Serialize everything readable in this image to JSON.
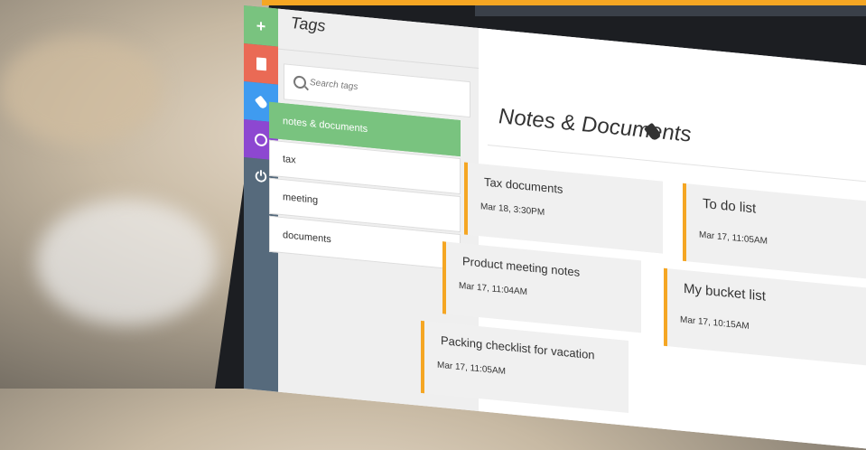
{
  "sidebar": {
    "items": [
      {
        "icon": "plus-icon",
        "color": "#79c37f"
      },
      {
        "icon": "document-icon",
        "color": "#ea6a55"
      },
      {
        "icon": "tag-icon",
        "color": "#3f9bf0"
      },
      {
        "icon": "clock-icon",
        "color": "#8d47d1"
      },
      {
        "icon": "power-icon",
        "color": "#566a7c"
      }
    ]
  },
  "tags_panel": {
    "title": "Tags",
    "search_placeholder": "Search tags",
    "tags": [
      {
        "label": "notes & documents",
        "active": true
      },
      {
        "label": "tax",
        "active": false
      },
      {
        "label": "meeting",
        "active": false
      },
      {
        "label": "documents",
        "active": false
      }
    ]
  },
  "main": {
    "title": "Notes & Documents",
    "notes": [
      {
        "title": "Tax documents",
        "date": "Mar 18, 3:30PM"
      },
      {
        "title": "Product meeting notes",
        "date": "Mar 17, 11:04AM"
      },
      {
        "title": "Packing checklist for vacation",
        "date": "Mar 17, 11:05AM"
      },
      {
        "title": "To do list",
        "date": "Mar 17, 11:05AM"
      },
      {
        "title": "My bucket list",
        "date": "Mar 17, 10:15AM"
      }
    ]
  },
  "colors": {
    "accent": "#f5a623",
    "active_tag": "#79c37f",
    "rail": "#566a7c"
  }
}
